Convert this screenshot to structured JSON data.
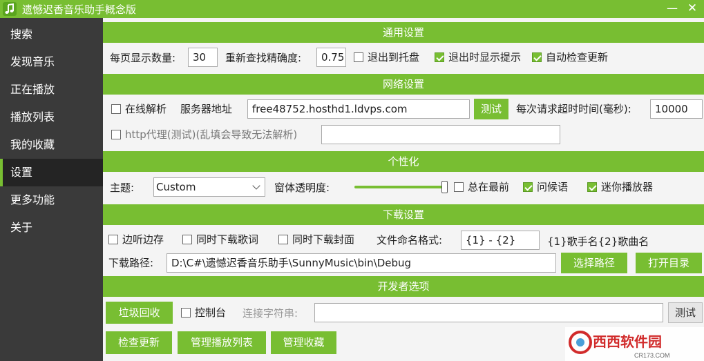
{
  "window": {
    "title": "遗憾迟香音乐助手概念版",
    "minimize_label": "—",
    "close_label": "✕",
    "accent_color": "#78be32"
  },
  "sidebar": {
    "items": [
      {
        "label": "搜索"
      },
      {
        "label": "发现音乐"
      },
      {
        "label": "正在播放"
      },
      {
        "label": "播放列表"
      },
      {
        "label": "我的收藏"
      },
      {
        "label": "设置"
      },
      {
        "label": "更多功能"
      },
      {
        "label": "关于"
      }
    ],
    "active": "设置"
  },
  "general": {
    "header": "通用设置",
    "page_count_label": "每页显示数量:",
    "page_count_value": "30",
    "precision_label": "重新查找精确度:",
    "precision_value": "0.75",
    "tray_label": "退出到托盘",
    "tray_checked": false,
    "exit_tip_label": "退出时显示提示",
    "exit_tip_checked": true,
    "auto_update_label": "自动检查更新",
    "auto_update_checked": true
  },
  "network": {
    "header": "网络设置",
    "online_parse_label": "在线解析",
    "online_parse_checked": false,
    "server_label": "服务器地址",
    "server_value": "free48752.hosthd1.ldvps.com",
    "test_label": "测试",
    "timeout_label": "每次请求超时时间(毫秒):",
    "timeout_value": "10000",
    "proxy_label": "http代理(测试)(乱填会导致无法解析)",
    "proxy_checked": false,
    "proxy_value": ""
  },
  "personalize": {
    "header": "个性化",
    "theme_label": "主题:",
    "theme_value": "Custom",
    "opacity_label": "窗体透明度:",
    "opacity_fraction": 1.0,
    "topmost_label": "总在最前",
    "topmost_checked": false,
    "greeting_label": "问候语",
    "greeting_checked": true,
    "mini_player_label": "迷你播放器",
    "mini_player_checked": true
  },
  "download": {
    "header": "下载设置",
    "play_and_save_label": "边听边存",
    "play_and_save_checked": false,
    "lyrics_label": "同时下载歌词",
    "lyrics_checked": false,
    "cover_label": "同时下载封面",
    "cover_checked": false,
    "naming_label": "文件命名格式:",
    "naming_value": "{1} - {2}",
    "naming_hint": "{1}歌手名{2}歌曲名",
    "path_label": "下载路径:",
    "path_value": "D:\\C#\\遗憾迟香音乐助手\\SunnyMusic\\bin\\Debug",
    "choose_path_label": "选择路径",
    "open_dir_label": "打开目录"
  },
  "developer": {
    "header": "开发者选项",
    "gc_label": "垃圾回收",
    "console_label": "控制台",
    "console_checked": false,
    "conn_label": "连接字符串:",
    "conn_value": "",
    "test_label": "测试",
    "check_update_label": "检查更新",
    "manage_playlist_label": "管理播放列表",
    "manage_fav_label": "管理收藏"
  },
  "watermark": {
    "text": "西西软件园",
    "sub": "CR173.COM"
  }
}
